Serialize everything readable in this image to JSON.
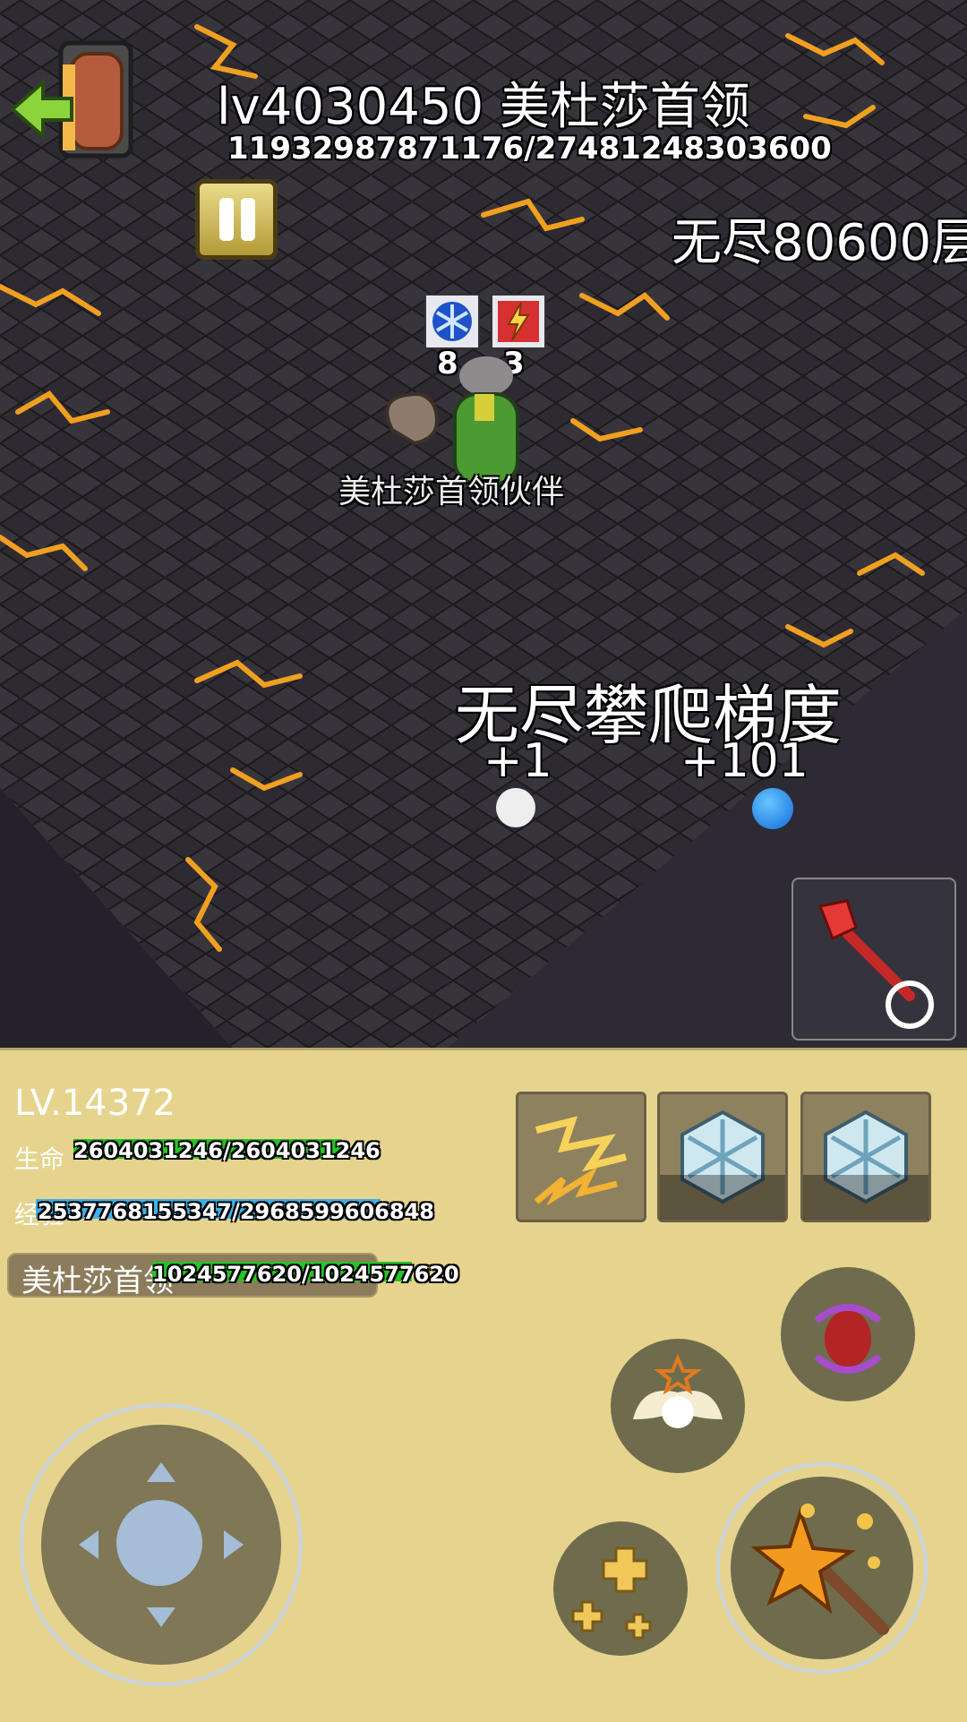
{
  "boss": {
    "title": "lv4030450 美杜莎首领",
    "hp": "11932987871176/27481248303600",
    "hp_fraction": 0.434
  },
  "floor_label": "无尽80600层",
  "buffs": [
    {
      "icon": "snowflake-icon",
      "count": "8"
    },
    {
      "icon": "lightning-icon",
      "count": "3"
    }
  ],
  "companion_name": "美杜莎首领伙伴",
  "gradient": {
    "title": "无尽攀爬梯度",
    "left_label": "+1",
    "right_label": "+101",
    "selected": "right"
  },
  "player": {
    "level": "LV.14372",
    "hp_label": "生命",
    "hp_value": "2604031246/2604031246",
    "hp_fraction": 1.0,
    "exp_label": "经验",
    "exp_value": "2537768155347/2968599606848",
    "exp_fraction": 0.855
  },
  "ally": {
    "name": "美杜莎首领",
    "hp_value": "1024577620/1024577620",
    "hp_fraction": 1.0
  },
  "skills": [
    {
      "icon": "lightning-icon"
    },
    {
      "icon": "snowflake-icon"
    },
    {
      "icon": "snowflake-icon"
    }
  ],
  "colors": {
    "panel_bg": "#e6d48e",
    "hp_green": "#27c327",
    "exp_blue": "#3fb0e8",
    "lava": "#f0a020"
  }
}
